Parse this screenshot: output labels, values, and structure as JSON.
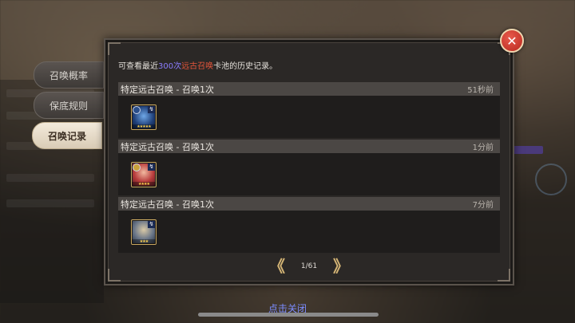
{
  "tabs": [
    {
      "label": "召唤概率",
      "active": false
    },
    {
      "label": "保底规则",
      "active": false
    },
    {
      "label": "召唤记录",
      "active": true
    }
  ],
  "description": {
    "prefix": "可查看最近",
    "count": "300次",
    "pool": "远古召唤",
    "suffix": "卡池的历史记录。"
  },
  "records": [
    {
      "title": "特定远古召唤 - 召唤1次",
      "time": "51秒前",
      "card": {
        "icon": "blue-dragon-hero-card",
        "type": "↯",
        "stars": "★★★★★"
      }
    },
    {
      "title": "特定远古召唤 - 召唤1次",
      "time": "1分前",
      "card": {
        "icon": "red-warrior-hero-card",
        "type": "↯",
        "stars": "★★★★"
      }
    },
    {
      "title": "特定远古召唤 - 召唤1次",
      "time": "7分前",
      "card": {
        "icon": "elder-sage-hero-card",
        "type": "↯",
        "stars": "★★★"
      }
    }
  ],
  "pager": {
    "prev": "《",
    "next": "》",
    "page": "1/61"
  },
  "close_icon": "✕",
  "tap_close": "点击关闭",
  "colors": {
    "accent_purple": "#8c7dff",
    "accent_red": "#e5553b",
    "close_red": "#c7372b",
    "arrow_gold": "#d6b676"
  }
}
